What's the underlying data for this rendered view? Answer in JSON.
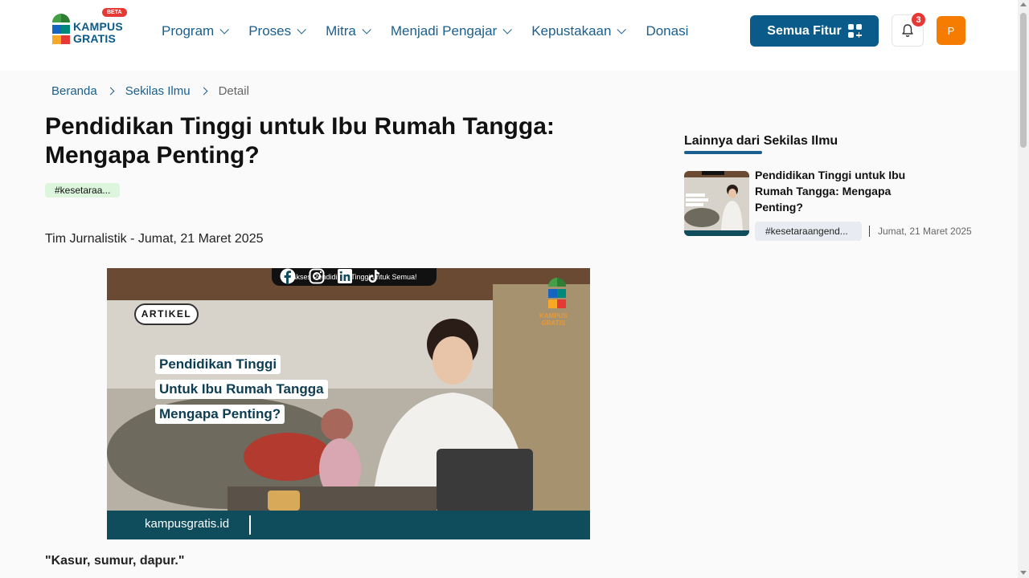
{
  "header": {
    "logo_text_line1": "KAMPUS",
    "logo_text_line2": "GRATIS",
    "beta_label": "BETA",
    "nav": [
      {
        "label": "Program"
      },
      {
        "label": "Proses"
      },
      {
        "label": "Mitra"
      },
      {
        "label": "Menjadi Pengajar"
      },
      {
        "label": "Kepustakaan"
      },
      {
        "label": "Donasi"
      }
    ],
    "features_button": "Semua Fitur",
    "notification_count": "3",
    "avatar_initial": "P"
  },
  "breadcrumb": {
    "home": "Beranda",
    "section": "Sekilas Ilmu",
    "current": "Detail"
  },
  "article": {
    "title": "Pendidikan Tinggi untuk Ibu Rumah Tangga: Mengapa Penting?",
    "tag": "#kesetaraa...",
    "byline": "Tim Jurnalistik - Jumat, 21 Maret 2025",
    "quote": "\"Kasur, sumur, dapur.\""
  },
  "hero_image": {
    "top_banner": "Akses Pendidikan Tinggi untuk Semua!",
    "badge": "ARTIKEL",
    "line1": "Pendidikan Tinggi",
    "line2": "Untuk Ibu Rumah Tangga",
    "line3": "Mengapa Penting?",
    "logo_text_line1": "KAMPUS",
    "logo_text_line2": "GRATIS",
    "url": "kampusgratis.id"
  },
  "sidebar": {
    "heading": "Lainnya dari Sekilas Ilmu",
    "items": [
      {
        "title": "Pendidikan Tinggi untuk Ibu Rumah Tangga: Mengapa Penting?",
        "tag": "#kesetaraangend...",
        "date": "Jumat, 21 Maret 2025"
      }
    ]
  },
  "colors": {
    "primary": "#0a5b8a",
    "nav_text": "#1a5f8e",
    "notification": "#e53935",
    "avatar": "#f57c00",
    "tag_green": "#dcf5dc",
    "hero_bar": "#0f4c5c"
  }
}
